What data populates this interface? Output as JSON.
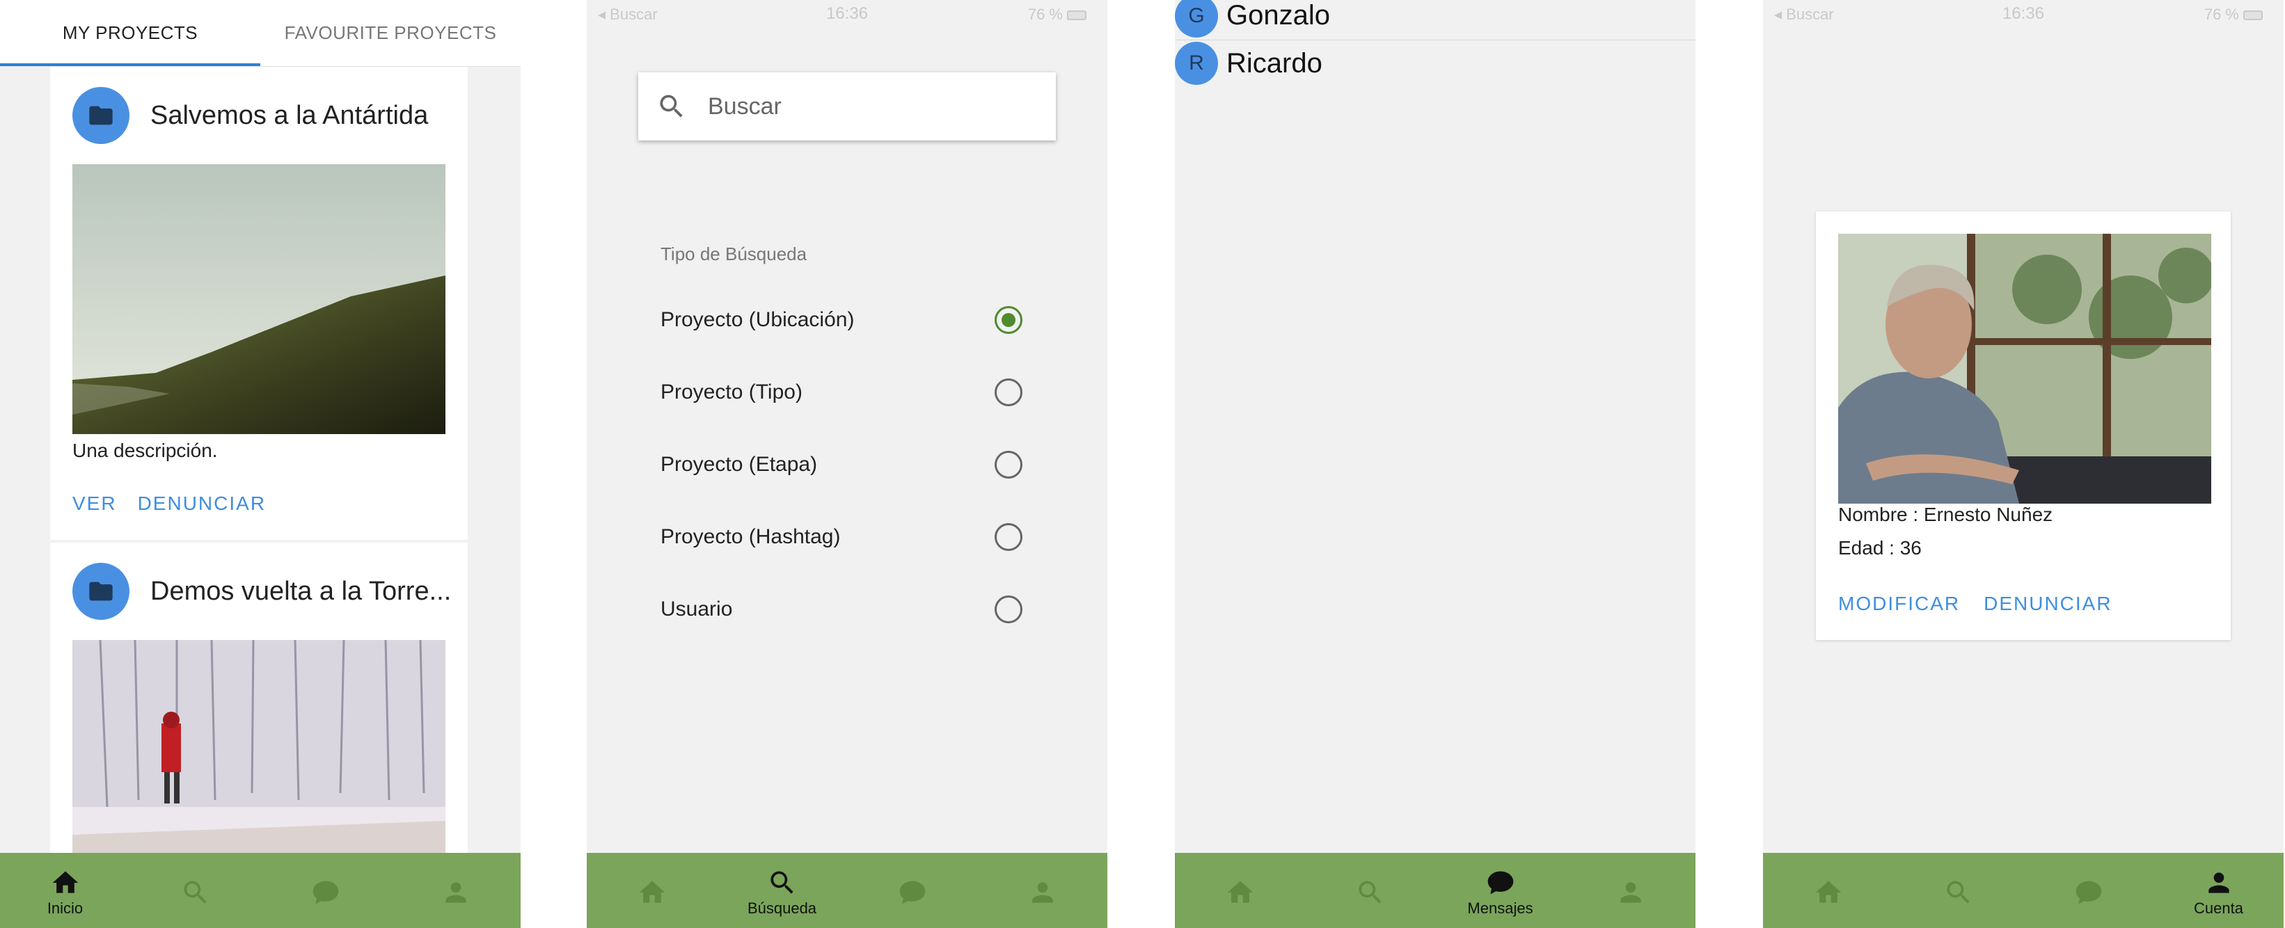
{
  "status_bar": {
    "carrier": "◂ Buscar",
    "time": "16:36",
    "battery": "76 %"
  },
  "screen1": {
    "tabs": [
      {
        "label": "MY PROYECTS"
      },
      {
        "label": "FAVOURITE PROYECTS"
      }
    ],
    "cards": [
      {
        "title": "Salvemos a la Antártida",
        "description": "Una descripción.",
        "actions": [
          "VER",
          "DENUNCIAR"
        ]
      },
      {
        "title": "Demos vuelta a la Torre..."
      }
    ]
  },
  "screen2": {
    "search_placeholder": "Buscar",
    "section_label": "Tipo de Búsqueda",
    "options": [
      {
        "label": "Proyecto (Ubicación)",
        "selected": true
      },
      {
        "label": "Proyecto (Tipo)",
        "selected": false
      },
      {
        "label": "Proyecto (Etapa)",
        "selected": false
      },
      {
        "label": "Proyecto (Hashtag)",
        "selected": false
      },
      {
        "label": "Usuario",
        "selected": false
      }
    ]
  },
  "screen3": {
    "conversations": [
      {
        "initial": "G",
        "name": "Gonzalo"
      },
      {
        "initial": "R",
        "name": "Ricardo"
      }
    ]
  },
  "screen4": {
    "name_line": "Nombre : Ernesto Nuñez",
    "age_line": "Edad : 36",
    "actions": [
      "MODIFICAR",
      "DENUNCIAR"
    ]
  },
  "nav": {
    "labels": [
      "Inicio",
      "Búsqueda",
      "Mensajes",
      "Cuenta"
    ]
  },
  "colors": {
    "nav_bg": "#7ba55b",
    "accent_blue": "#3d8ee0",
    "radio_green": "#4e8a2e",
    "avatar_blue": "#4a90e2"
  }
}
